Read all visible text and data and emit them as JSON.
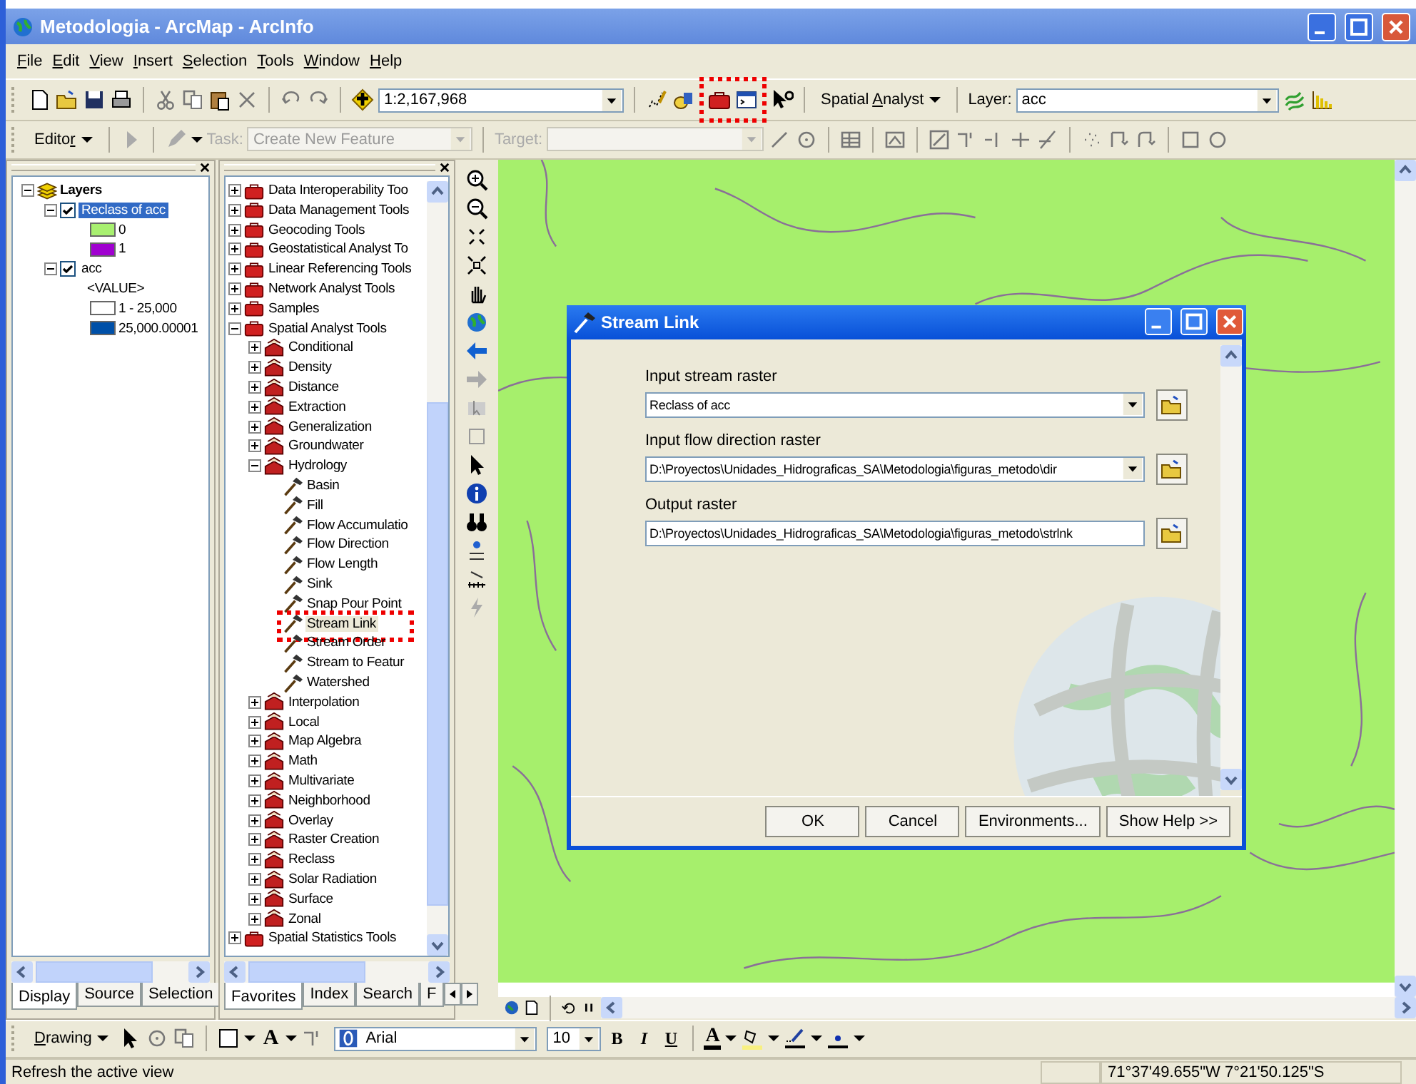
{
  "window": {
    "title": "Metodologia - ArcMap - ArcInfo"
  },
  "menu": [
    {
      "key": "F",
      "rest": "ile"
    },
    {
      "key": "E",
      "rest": "dit"
    },
    {
      "key": "V",
      "rest": "iew"
    },
    {
      "key": "I",
      "rest": "nsert"
    },
    {
      "key": "S",
      "rest": "election"
    },
    {
      "key": "T",
      "rest": "ools"
    },
    {
      "key": "W",
      "rest": "indow"
    },
    {
      "key": "H",
      "rest": "elp"
    }
  ],
  "standard_toolbar": {
    "scale": "1:2,167,968",
    "spatial_analyst": {
      "pre": "Spatial ",
      "key": "A",
      "rest": "nalyst"
    },
    "layer_label": "Layer:",
    "layer": "acc"
  },
  "editor_toolbar": {
    "editor": {
      "pre": "Edito",
      "key": "r"
    },
    "task_label": "Task:",
    "task": "Create New Feature",
    "target_label": "Target:"
  },
  "table_of_contents": {
    "title": "Layers",
    "layers": [
      {
        "name": "Reclass of acc",
        "checked": true,
        "expanded": true,
        "selected": true,
        "legend": [
          {
            "label": "0",
            "color": "#a8f070"
          },
          {
            "label": "1",
            "color": "#a000d0"
          }
        ]
      },
      {
        "name": "acc",
        "checked": true,
        "expanded": true,
        "selected": false,
        "field": "<VALUE>",
        "legend": [
          {
            "label": "1 - 25,000",
            "color": "#ffffff"
          },
          {
            "label": "25,000.00001",
            "color": "#0050a8"
          }
        ]
      }
    ],
    "tabs": [
      {
        "label": "Display",
        "selected": true
      },
      {
        "label": "Source",
        "selected": false
      },
      {
        "label": "Selection",
        "selected": false
      }
    ]
  },
  "toolbox": {
    "items": [
      {
        "label": "Data Interoperability Too",
        "kind": "toolbox",
        "expanded": false
      },
      {
        "label": "Data Management Tools",
        "kind": "toolbox",
        "expanded": false
      },
      {
        "label": "Geocoding Tools",
        "kind": "toolbox",
        "expanded": false
      },
      {
        "label": "Geostatistical Analyst To",
        "kind": "toolbox",
        "expanded": false
      },
      {
        "label": "Linear Referencing Tools",
        "kind": "toolbox",
        "expanded": false
      },
      {
        "label": "Network Analyst Tools",
        "kind": "toolbox",
        "expanded": false
      },
      {
        "label": "Samples",
        "kind": "toolbox",
        "expanded": false
      },
      {
        "label": "Spatial Analyst Tools",
        "kind": "toolbox",
        "expanded": true,
        "children": [
          {
            "label": "Conditional",
            "kind": "toolset",
            "expanded": false
          },
          {
            "label": "Density",
            "kind": "toolset",
            "expanded": false
          },
          {
            "label": "Distance",
            "kind": "toolset",
            "expanded": false
          },
          {
            "label": "Extraction",
            "kind": "toolset",
            "expanded": false
          },
          {
            "label": "Generalization",
            "kind": "toolset",
            "expanded": false
          },
          {
            "label": "Groundwater",
            "kind": "toolset",
            "expanded": false
          },
          {
            "label": "Hydrology",
            "kind": "toolset",
            "expanded": true,
            "children": [
              {
                "label": "Basin",
                "kind": "tool",
                "selected": false
              },
              {
                "label": "Fill",
                "kind": "tool",
                "selected": false
              },
              {
                "label": "Flow Accumulatio",
                "kind": "tool",
                "selected": false
              },
              {
                "label": "Flow Direction",
                "kind": "tool",
                "selected": false
              },
              {
                "label": "Flow Length",
                "kind": "tool",
                "selected": false
              },
              {
                "label": "Sink",
                "kind": "tool",
                "selected": false
              },
              {
                "label": "Snap Pour Point",
                "kind": "tool",
                "selected": false
              },
              {
                "label": "Stream Link",
                "kind": "tool",
                "selected": true
              },
              {
                "label": "Stream Order",
                "kind": "tool",
                "selected": false
              },
              {
                "label": "Stream to Featur",
                "kind": "tool",
                "selected": false
              },
              {
                "label": "Watershed",
                "kind": "tool",
                "selected": false
              }
            ]
          },
          {
            "label": "Interpolation",
            "kind": "toolset",
            "expanded": false
          },
          {
            "label": "Local",
            "kind": "toolset",
            "expanded": false
          },
          {
            "label": "Map Algebra",
            "kind": "toolset",
            "expanded": false
          },
          {
            "label": "Math",
            "kind": "toolset",
            "expanded": false
          },
          {
            "label": "Multivariate",
            "kind": "toolset",
            "expanded": false
          },
          {
            "label": "Neighborhood",
            "kind": "toolset",
            "expanded": false
          },
          {
            "label": "Overlay",
            "kind": "toolset",
            "expanded": false
          },
          {
            "label": "Raster Creation",
            "kind": "toolset",
            "expanded": false
          },
          {
            "label": "Reclass",
            "kind": "toolset",
            "expanded": false
          },
          {
            "label": "Solar Radiation",
            "kind": "toolset",
            "expanded": false
          },
          {
            "label": "Surface",
            "kind": "toolset",
            "expanded": false
          },
          {
            "label": "Zonal",
            "kind": "toolset",
            "expanded": false
          }
        ]
      },
      {
        "label": "Spatial Statistics Tools",
        "kind": "toolbox",
        "expanded": false
      }
    ],
    "tabs": [
      {
        "label": "Favorites",
        "selected": true
      },
      {
        "label": "Index",
        "selected": false
      },
      {
        "label": "Search",
        "selected": false
      },
      {
        "label": "F",
        "selected": false
      }
    ]
  },
  "dialog": {
    "title": "Stream Link",
    "fields": [
      {
        "label": "Input stream raster",
        "value": "Reclass of acc",
        "kind": "dropdown"
      },
      {
        "label": "Input flow direction raster",
        "value": "D:\\Proyectos\\Unidades_Hidrograficas_SA\\Metodologia\\figuras_metodo\\dir",
        "kind": "dropdown"
      },
      {
        "label": "Output raster",
        "value": "D:\\Proyectos\\Unidades_Hidrograficas_SA\\Metodologia\\figuras_metodo\\strlnk",
        "kind": "text"
      }
    ],
    "buttons": [
      "OK",
      "Cancel",
      "Environments...",
      "Show Help >>"
    ]
  },
  "drawing_toolbar": {
    "drawing": {
      "key": "D",
      "rest": "rawing"
    },
    "text_tool": "A",
    "font": "Arial",
    "size": "10",
    "bold": "B",
    "italic": "I",
    "underline": "U",
    "font_color": "A"
  },
  "status_bar": {
    "message": "Refresh the active view",
    "coordinates": "71°37'49.655\"W  7°21'50.125\"S"
  }
}
